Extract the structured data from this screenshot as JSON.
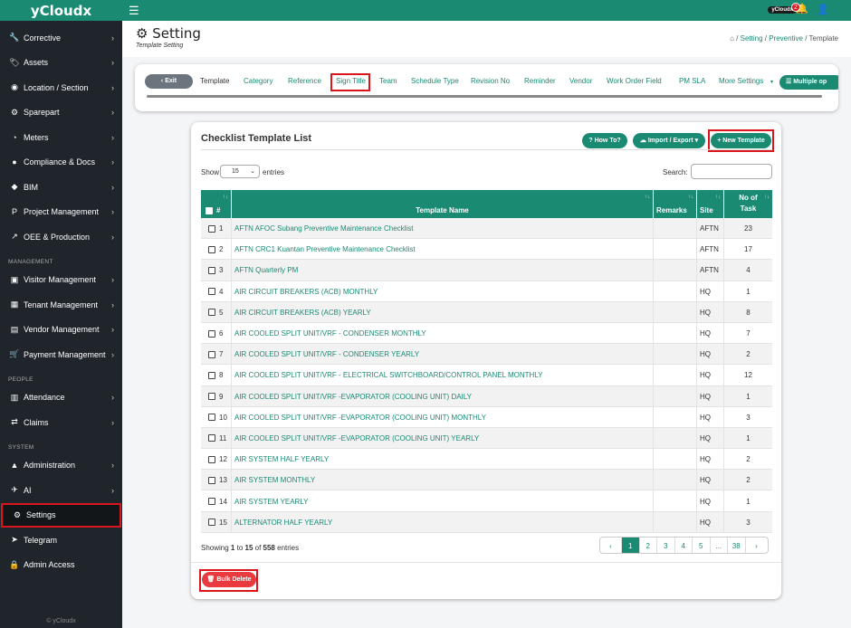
{
  "brand": "yCloudx",
  "sidebar": {
    "items": [
      {
        "label": "Corrective",
        "icon": "wrench-icon",
        "glyph": "🔧"
      },
      {
        "label": "Assets",
        "icon": "tag-icon",
        "glyph": "🏷"
      },
      {
        "label": "Location / Section",
        "icon": "location-icon",
        "glyph": "◉"
      },
      {
        "label": "Sparepart",
        "icon": "cogs-icon",
        "glyph": "⚙"
      },
      {
        "label": "Meters",
        "icon": "meter-icon",
        "glyph": "◔"
      },
      {
        "label": "Compliance & Docs",
        "icon": "compliance-icon",
        "glyph": "●"
      },
      {
        "label": "BIM",
        "icon": "cube-icon",
        "glyph": "◆"
      },
      {
        "label": "Project Management",
        "icon": "project-icon",
        "glyph": "P"
      },
      {
        "label": "OEE & Production",
        "icon": "chart-icon",
        "glyph": "↗"
      }
    ],
    "section_management": "MANAGEMENT",
    "management": [
      {
        "label": "Visitor Management",
        "icon": "id-card-icon",
        "glyph": "▣"
      },
      {
        "label": "Tenant Management",
        "icon": "tenant-icon",
        "glyph": "▦"
      },
      {
        "label": "Vendor Management",
        "icon": "vendor-icon",
        "glyph": "▤"
      },
      {
        "label": "Payment Management",
        "icon": "payment-icon",
        "glyph": "🛒"
      }
    ],
    "section_people": "PEOPLE",
    "people": [
      {
        "label": "Attendance",
        "icon": "attendance-icon",
        "glyph": "▥"
      },
      {
        "label": "Claims",
        "icon": "claims-icon",
        "glyph": "⇄"
      }
    ],
    "section_system": "SYSTEM",
    "system": [
      {
        "label": "Administration",
        "icon": "admin-icon",
        "glyph": "▲",
        "chev": true
      },
      {
        "label": "AI",
        "icon": "ai-icon",
        "glyph": "✈",
        "chev": true
      },
      {
        "label": "Settings",
        "icon": "settings-icon",
        "glyph": "⚙",
        "chev": false,
        "active": true
      },
      {
        "label": "Telegram",
        "icon": "telegram-icon",
        "glyph": "➤",
        "chev": false
      },
      {
        "label": "Admin Access",
        "icon": "lock-icon",
        "glyph": "🔒",
        "chev": false
      }
    ],
    "footer": "© yCloudx"
  },
  "topbar": {
    "pill": "yCloudx",
    "notif_count": "2"
  },
  "header": {
    "title": "Setting",
    "subtitle": "Template Setting",
    "crumbs": [
      "Setting",
      "Preventive"
    ],
    "crumb_current": "Template"
  },
  "tabs": {
    "exit": "Exit",
    "items": [
      "Template",
      "Category",
      "Reference",
      "Sign Title",
      "Team",
      "Schedule Type",
      "Revision No",
      "Reminder",
      "Vendor",
      "Work Order Field",
      "PM SLA",
      "More Settings"
    ],
    "multiple": "Multiple op"
  },
  "card": {
    "title": "Checklist Template List",
    "how_to": "How To?",
    "import_export": "Import / Export",
    "new_template": "New Template",
    "show": "Show",
    "entries_value": "15",
    "entries": "entries",
    "search_label": "Search:",
    "columns": [
      "#",
      "Template Name",
      "Remarks",
      "Site",
      "No of Task"
    ],
    "rows": [
      {
        "n": "1",
        "name": "AFTN AFOC Subang Preventive Maintenance Checklist",
        "remarks": "",
        "site": "AFTN",
        "tasks": "23"
      },
      {
        "n": "2",
        "name": "AFTN CRC1 Kuantan Preventive Maintenance Checklist",
        "remarks": "",
        "site": "AFTN",
        "tasks": "17"
      },
      {
        "n": "3",
        "name": "AFTN Quarterly PM",
        "remarks": "",
        "site": "AFTN",
        "tasks": "4"
      },
      {
        "n": "4",
        "name": "AIR CIRCUIT BREAKERS (ACB) MONTHLY",
        "remarks": "",
        "site": "HQ",
        "tasks": "1"
      },
      {
        "n": "5",
        "name": "AIR CIRCUIT BREAKERS (ACB) YEARLY",
        "remarks": "",
        "site": "HQ",
        "tasks": "8"
      },
      {
        "n": "6",
        "name": "AIR COOLED SPLIT UNIT/VRF - CONDENSER MONTHLY",
        "remarks": "",
        "site": "HQ",
        "tasks": "7"
      },
      {
        "n": "7",
        "name": "AIR COOLED SPLIT UNIT/VRF - CONDENSER YEARLY",
        "remarks": "",
        "site": "HQ",
        "tasks": "2"
      },
      {
        "n": "8",
        "name": "AIR COOLED SPLIT UNIT/VRF - ELECTRICAL SWITCHBOARD/CONTROL PANEL MONTHLY",
        "remarks": "",
        "site": "HQ",
        "tasks": "12"
      },
      {
        "n": "9",
        "name": "AIR COOLED SPLIT UNIT/VRF -EVAPORATOR (COOLING UNIT) DAILY",
        "remarks": "",
        "site": "HQ",
        "tasks": "1"
      },
      {
        "n": "10",
        "name": "AIR COOLED SPLIT UNIT/VRF -EVAPORATOR (COOLING UNIT) MONTHLY",
        "remarks": "",
        "site": "HQ",
        "tasks": "3"
      },
      {
        "n": "11",
        "name": "AIR COOLED SPLIT UNIT/VRF -EVAPORATOR (COOLING UNIT) YEARLY",
        "remarks": "",
        "site": "HQ",
        "tasks": "1"
      },
      {
        "n": "12",
        "name": "AIR SYSTEM HALF YEARLY",
        "remarks": "",
        "site": "HQ",
        "tasks": "2"
      },
      {
        "n": "13",
        "name": "AIR SYSTEM MONTHLY",
        "remarks": "",
        "site": "HQ",
        "tasks": "2"
      },
      {
        "n": "14",
        "name": "AIR SYSTEM YEARLY",
        "remarks": "",
        "site": "HQ",
        "tasks": "1"
      },
      {
        "n": "15",
        "name": "ALTERNATOR HALF YEARLY",
        "remarks": "",
        "site": "HQ",
        "tasks": "3"
      }
    ],
    "showing_pre": "Showing ",
    "showing_from": "1",
    "showing_mid1": " to ",
    "showing_to": "15",
    "showing_mid2": " of ",
    "showing_total": "558",
    "showing_post": " entries",
    "pages": [
      "1",
      "2",
      "3",
      "4",
      "5",
      "...",
      "38"
    ],
    "bulk_delete": "Bulk Delete"
  },
  "colors": {
    "primary": "#1a8a73",
    "danger": "#d9161c",
    "sidebar": "#1f252b"
  }
}
